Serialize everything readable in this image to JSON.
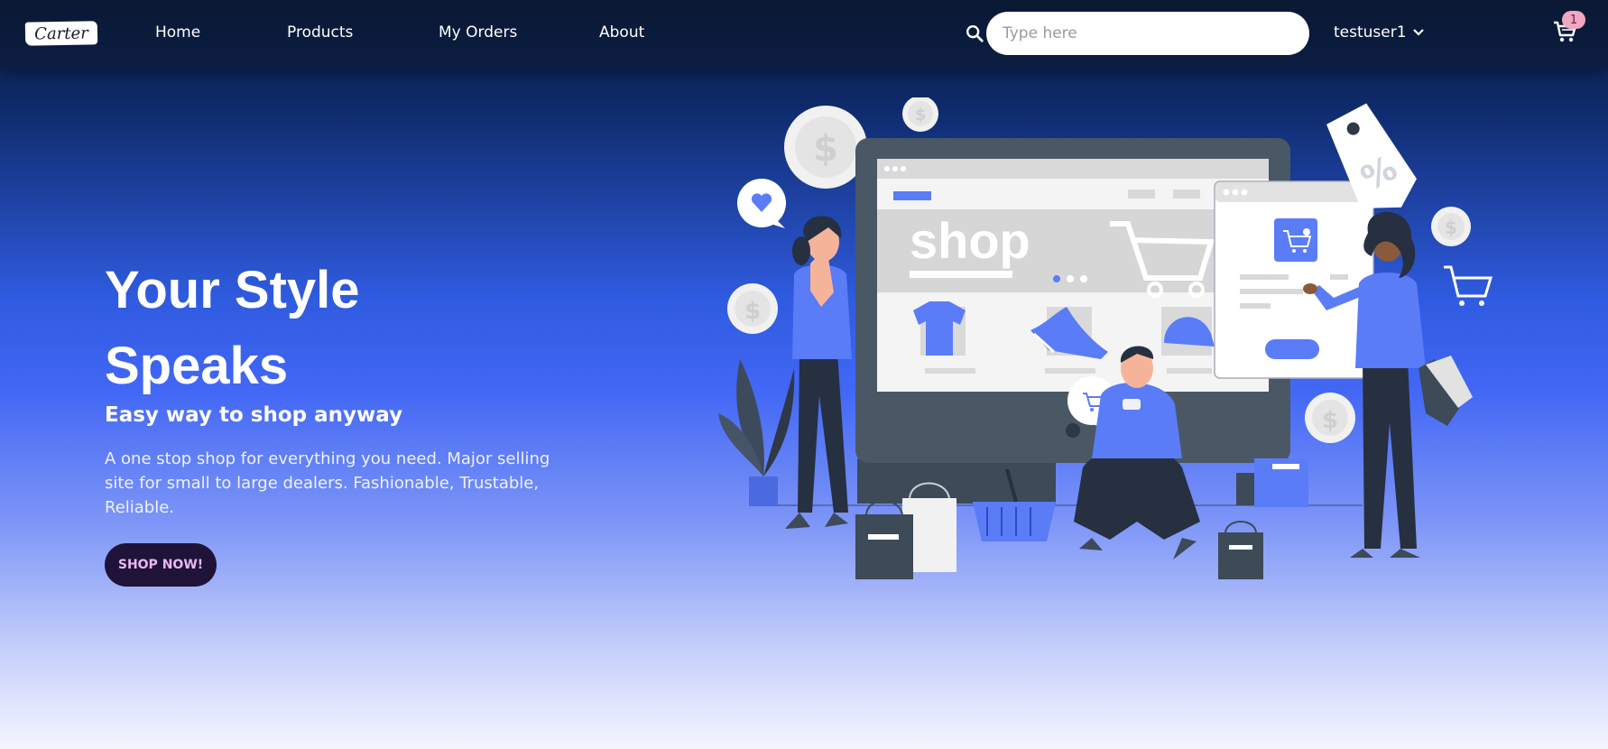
{
  "brand": {
    "logo_text": "Carter"
  },
  "nav": {
    "links": [
      {
        "label": "Home"
      },
      {
        "label": "Products"
      },
      {
        "label": "My Orders"
      },
      {
        "label": "About"
      }
    ]
  },
  "search": {
    "placeholder": "Type here",
    "value": ""
  },
  "user": {
    "name": "testuser1"
  },
  "cart": {
    "count": "1"
  },
  "hero": {
    "title_line1": "Your Style",
    "title_line2": "Speaks",
    "subtitle": "Easy way to shop anyway",
    "description": "A one stop shop for everything you need. Major selling site for small to large dealers. Fashionable, Trustable, Reliable.",
    "cta_label": "SHOP NOW!"
  },
  "illustration": {
    "shop_text": "shop",
    "percent_tag": "%"
  },
  "colors": {
    "nav_bg": "#0b1d42",
    "accent_blue": "#5b7cf7",
    "cta_bg": "#20133a",
    "cta_text": "#e9b7f3",
    "badge_bg": "#f3a6c2"
  }
}
